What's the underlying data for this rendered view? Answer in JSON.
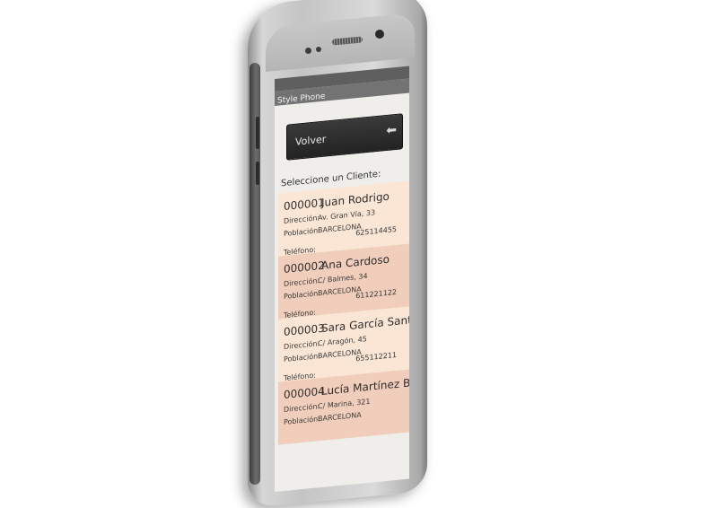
{
  "app": {
    "title": "Style Phone"
  },
  "back_button": {
    "label": "Volver",
    "icon": "back-arrow-icon"
  },
  "prompt": "Seleccione un Cliente:",
  "labels": {
    "address": "Dirección:",
    "city": "Población:",
    "phone": "Teléfono:"
  },
  "clients": [
    {
      "code": "000001",
      "name": "Juan Rodrigo",
      "address": "Av. Gran Vía, 33",
      "city": "BARCELONA",
      "phone": "625114455"
    },
    {
      "code": "000002",
      "name": "Ana Cardoso",
      "address": "C/ Balmes, 34",
      "city": "BARCELONA",
      "phone": "611221122"
    },
    {
      "code": "000003",
      "name": "Sara García Santana",
      "address": "C/ Aragón, 45",
      "city": "BARCELONA",
      "phone": "655112211"
    },
    {
      "code": "000004",
      "name": "Lucía Martínez Baena",
      "address": "C/ Marina, 321",
      "city": "BARCELONA",
      "phone": ""
    }
  ],
  "colors": {
    "row_light": "#fbe6d6",
    "row_dark": "#f1cdbb",
    "button": "#2b2b2b",
    "screen": "#efeeea"
  }
}
